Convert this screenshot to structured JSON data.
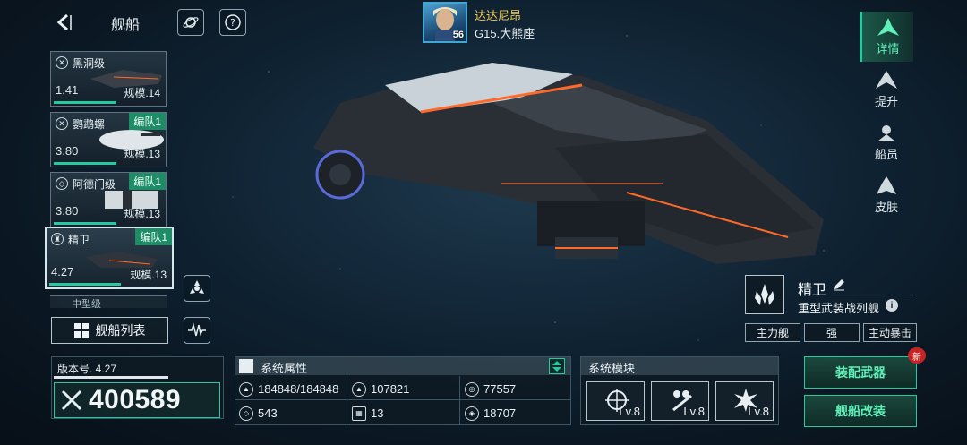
{
  "header": {
    "title": "舰船",
    "player_name": "达达尼昂",
    "player_level": "56",
    "player_location": "G15.大熊座"
  },
  "ship_list": [
    {
      "name": "黑洞级",
      "version": "1.41",
      "scale": "规模.14",
      "fleet_tag": ""
    },
    {
      "name": "鹦鹉螺",
      "version": "3.80",
      "scale": "规模.13",
      "fleet_tag": "编队1"
    },
    {
      "name": "阿德门级",
      "version": "3.80",
      "scale": "规模.13",
      "fleet_tag": "编队1"
    },
    {
      "name": "精卫",
      "version": "4.27",
      "scale": "规模.13",
      "fleet_tag": "编队1"
    }
  ],
  "ship_list_partial_name": "中型级",
  "ship_list_button": "舰船列表",
  "version_panel": {
    "label": "版本号. 4.27",
    "power": "400589"
  },
  "attributes": {
    "title": "系统属性",
    "cells": [
      "184848/184848",
      "107821",
      "77557",
      "543",
      "13",
      "18707"
    ]
  },
  "modules": {
    "title": "系统模块",
    "levels": [
      "Lv.8",
      "Lv.8",
      "Lv.8"
    ]
  },
  "ship_info": {
    "name": "精卫",
    "type": "重型武装战列舰",
    "tags": [
      "主力舰",
      "强",
      "主动暴击"
    ]
  },
  "actions": {
    "equip_weapons": "装配武器",
    "modify_ship": "舰船改装",
    "new_badge": "新"
  },
  "side_tabs": [
    {
      "label": "详情",
      "icon": "detail-icon",
      "active": true
    },
    {
      "label": "提升",
      "icon": "upgrade-icon",
      "active": false
    },
    {
      "label": "船员",
      "icon": "crew-icon",
      "active": false
    },
    {
      "label": "皮肤",
      "icon": "skin-icon",
      "active": false
    }
  ],
  "colors": {
    "accent_green": "#26c9a0",
    "gold": "#f2c94c",
    "badge_red": "#c82323"
  }
}
